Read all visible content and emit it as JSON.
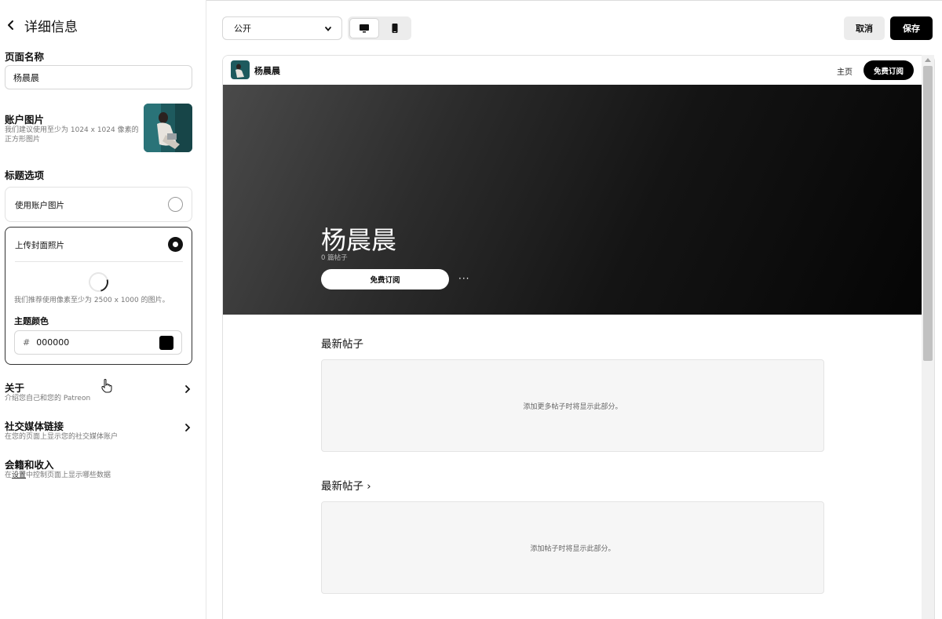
{
  "sidebar": {
    "title": "详细信息",
    "page_name_label": "页面名称",
    "page_name_value": "杨晨晨",
    "account_image_label": "账户图片",
    "account_image_hint_1": "我们建议使用至少为 1024 x 1024 像素的",
    "account_image_hint_2": "正方形图片",
    "header_options_label": "标题选项",
    "option_use_account_image": "使用账户图片",
    "option_upload_cover": "上传封面照片",
    "cover_hint": "我们推荐使用像素至少为 2500 x 1000 的图片。",
    "theme_color_label": "主题颜色",
    "theme_color_hash": "#",
    "theme_color_value": "000000",
    "about_title": "关于",
    "about_desc": "介绍您自己和您的 Patreon",
    "social_title": "社交媒体链接",
    "social_desc": "在您的页面上显示您的社交媒体账户",
    "membership_title": "会籍和收入",
    "membership_desc_prefix": "在",
    "membership_desc_link": "设置",
    "membership_desc_suffix": "中控制页面上显示哪些数据"
  },
  "toolbar": {
    "visibility_value": "公开",
    "cancel_label": "取消",
    "save_label": "保存"
  },
  "preview": {
    "header_name": "杨晨晨",
    "nav_home": "主页",
    "subscribe_label": "免费订阅",
    "banner_name": "杨晨晨",
    "post_count": "0 篇帖子",
    "banner_subscribe": "免费订阅",
    "more": "···",
    "section1_title": "最新帖子",
    "section1_empty": "添加更多帖子时将显示此部分。",
    "section2_title": "最新帖子 ›",
    "section2_empty": "添加帖子时将显示此部分。"
  },
  "colors": {
    "theme": "#000000",
    "accent": "#000000"
  }
}
